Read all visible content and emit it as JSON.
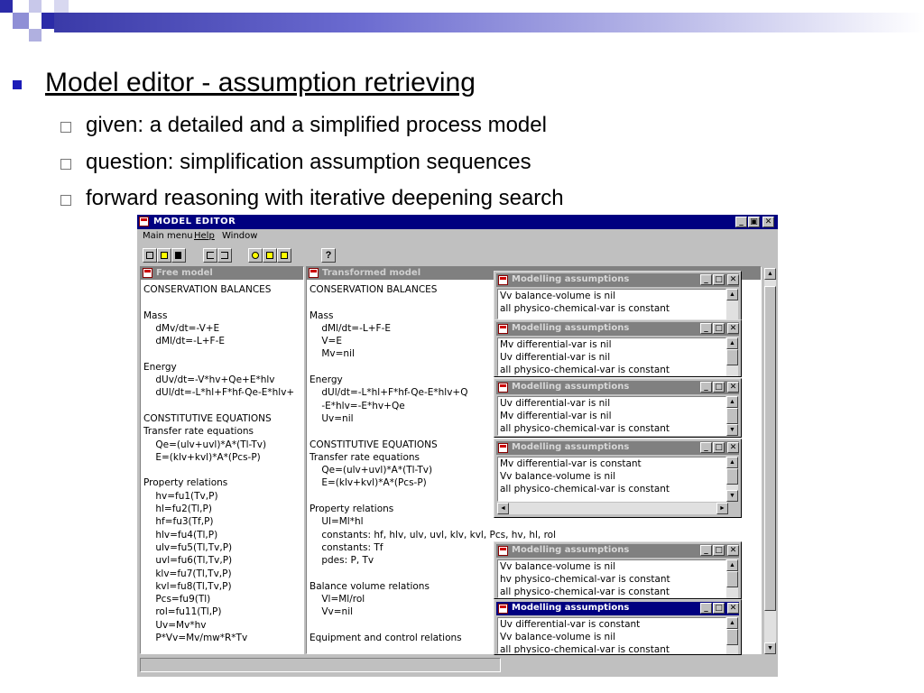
{
  "slide": {
    "title": "Model editor - assumption retrieving",
    "bullets": [
      "given: a detailed and a simplified process model",
      "question: simplification assumption sequences",
      "forward reasoning with iterative deepening search"
    ],
    "colors": {
      "accent": "#1c1cb8",
      "titlebar": "#000080"
    }
  },
  "app": {
    "title": "MODEL EDITOR",
    "window_buttons": [
      "_",
      "ę",
      "×"
    ],
    "menu": [
      "Main menu",
      "Help",
      "Window"
    ],
    "toolbar_icons": [
      "new-icon",
      "open-icon",
      "save-icon",
      "undo-icon",
      "redo-icon",
      "cut-icon",
      "copy-icon",
      "paste-icon",
      "help-icon"
    ],
    "help_glyph": "?"
  },
  "free_model": {
    "title": "Free model",
    "lines": [
      "CONSERVATION BALANCES",
      "",
      "Mass",
      "    dMv/dt=-V+E",
      "    dMl/dt=-L+F-E",
      "",
      "Energy",
      "    dUv/dt=-V*hv+Qe+E*hlv",
      "    dUl/dt=-L*hl+F*hf-Qe-E*hlv+",
      "",
      "CONSTITUTIVE EQUATIONS",
      "Transfer rate equations",
      "    Qe=(ulv+uvl)*A*(Tl-Tv)",
      "    E=(klv+kvl)*A*(Pcs-P)",
      "",
      "Property relations",
      "    hv=fu1(Tv,P)",
      "    hl=fu2(Tl,P)",
      "    hf=fu3(Tf,P)",
      "    hlv=fu4(Tl,P)",
      "    ulv=fu5(Tl,Tv,P)",
      "    uvl=fu6(Tl,Tv,P)",
      "    klv=fu7(Tl,Tv,P)",
      "    kvl=fu8(Tl,Tv,P)",
      "    Pcs=fu9(Tl)",
      "    rol=fu11(Tl,P)",
      "    Uv=Mv*hv",
      "    P*Vv=Mv/mw*R*Tv"
    ]
  },
  "transformed_model": {
    "title": "Transformed model",
    "lines": [
      "CONSERVATION BALANCES",
      "",
      "Mass",
      "    dMl/dt=-L+F-E",
      "    V=E",
      "    Mv=nil",
      "",
      "Energy",
      "    dUl/dt=-L*hl+F*hf-Qe-E*hlv+Q",
      "    -E*hlv=-E*hv+Qe",
      "    Uv=nil",
      "",
      "CONSTITUTIVE EQUATIONS",
      "Transfer rate equations",
      "    Qe=(ulv+uvl)*A*(Tl-Tv)",
      "    E=(klv+kvl)*A*(Pcs-P)",
      "",
      "Property relations",
      "    Ul=Ml*hl",
      "    constants: hf, hlv, ulv, uvl, klv, kvl, Pcs, hv, hl, rol",
      "    constants: Tf",
      "    pdes: P, Tv",
      "",
      "Balance volume relations",
      "    Vl=Ml/rol",
      "    Vv=nil",
      "",
      "Equipment and control relations"
    ]
  },
  "assumption_windows": [
    {
      "title": "Modelling assumptions",
      "lines": [
        "Vv balance-volume is nil",
        "all physico-chemical-var is constant"
      ]
    },
    {
      "title": "Modelling assumptions",
      "lines": [
        "Mv differential-var is nil",
        "Uv differential-var is nil",
        "all physico-chemical-var is constant"
      ]
    },
    {
      "title": "Modelling assumptions",
      "lines": [
        "Uv differential-var is nil",
        "Mv differential-var is nil",
        "all physico-chemical-var is constant"
      ]
    },
    {
      "title": "Modelling assumptions",
      "lines": [
        "Mv differential-var is constant",
        "Vv balance-volume is nil",
        "all physico-chemical-var is constant"
      ]
    },
    {
      "title": "Modelling assumptions",
      "lines": [
        "Vv balance-volume is nil",
        "hv physico-chemical-var is constant",
        "all physico-chemical-var is constant"
      ]
    },
    {
      "title": "Modelling assumptions",
      "lines": [
        "Uv differential-var is constant",
        "Vv balance-volume is nil",
        "all physico-chemical-var is constant"
      ]
    }
  ]
}
